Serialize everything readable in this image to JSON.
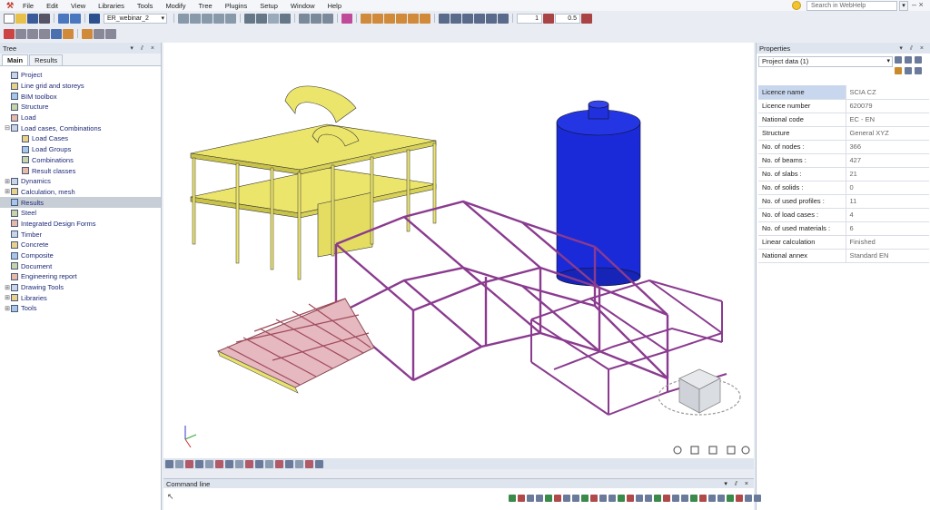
{
  "menu": {
    "items": [
      "File",
      "Edit",
      "View",
      "Libraries",
      "Tools",
      "Modify",
      "Tree",
      "Plugins",
      "Setup",
      "Window",
      "Help"
    ],
    "search_placeholder": "Search in WebHelp"
  },
  "toolbar": {
    "project_name": "ER_webinar_2",
    "zoom_value": "1",
    "scale_value": "0.5"
  },
  "tree": {
    "title": "Tree",
    "tabs": [
      "Main",
      "Results"
    ],
    "nodes": [
      {
        "label": "Project",
        "level": 0,
        "exp": ""
      },
      {
        "label": "Line grid and storeys",
        "level": 0,
        "exp": ""
      },
      {
        "label": "BIM toolbox",
        "level": 0,
        "exp": ""
      },
      {
        "label": "Structure",
        "level": 0,
        "exp": ""
      },
      {
        "label": "Load",
        "level": 0,
        "exp": ""
      },
      {
        "label": "Load cases, Combinations",
        "level": 0,
        "exp": "−"
      },
      {
        "label": "Load Cases",
        "level": 1,
        "exp": ""
      },
      {
        "label": "Load Groups",
        "level": 1,
        "exp": ""
      },
      {
        "label": "Combinations",
        "level": 1,
        "exp": ""
      },
      {
        "label": "Result classes",
        "level": 1,
        "exp": ""
      },
      {
        "label": "Dynamics",
        "level": 0,
        "exp": "+"
      },
      {
        "label": "Calculation, mesh",
        "level": 0,
        "exp": "+"
      },
      {
        "label": "Results",
        "level": 0,
        "exp": "",
        "selected": true
      },
      {
        "label": "Steel",
        "level": 0,
        "exp": ""
      },
      {
        "label": "Integrated Design Forms",
        "level": 0,
        "exp": ""
      },
      {
        "label": "Timber",
        "level": 0,
        "exp": ""
      },
      {
        "label": "Concrete",
        "level": 0,
        "exp": ""
      },
      {
        "label": "Composite",
        "level": 0,
        "exp": ""
      },
      {
        "label": "Document",
        "level": 0,
        "exp": ""
      },
      {
        "label": "Engineering report",
        "level": 0,
        "exp": ""
      },
      {
        "label": "Drawing Tools",
        "level": 0,
        "exp": "+"
      },
      {
        "label": "Libraries",
        "level": 0,
        "exp": "+"
      },
      {
        "label": "Tools",
        "level": 0,
        "exp": "+"
      }
    ]
  },
  "properties": {
    "title": "Properties",
    "selector": "Project data (1)",
    "rows": [
      {
        "key": "Licence name",
        "value": "SCIA CZ"
      },
      {
        "key": "Licence number",
        "value": "620079"
      },
      {
        "key": "National code",
        "value": "EC - EN"
      },
      {
        "key": "Structure",
        "value": "General XYZ"
      },
      {
        "key": "No. of nodes :",
        "value": "366"
      },
      {
        "key": "No. of beams :",
        "value": "427"
      },
      {
        "key": "No. of slabs :",
        "value": "21"
      },
      {
        "key": "No. of solids :",
        "value": "0"
      },
      {
        "key": "No. of used profiles :",
        "value": "11"
      },
      {
        "key": "No. of load cases :",
        "value": "4"
      },
      {
        "key": "No. of used materials :",
        "value": "6"
      },
      {
        "key": "Linear calculation",
        "value": "Finished"
      },
      {
        "key": "National annex",
        "value": "Standard EN"
      }
    ]
  },
  "command_line": {
    "title": "Command line"
  },
  "colors": {
    "building": "#e9e26a",
    "tank": "#1a2ad8",
    "frame": "#8a3b8f",
    "roof": "#c47a8a"
  }
}
